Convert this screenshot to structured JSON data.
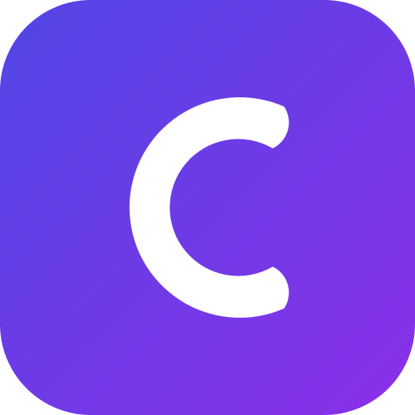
{
  "icon": {
    "name": "c-letter-app-icon",
    "glyph": "C",
    "colors": {
      "gradient_start": "#5146E5",
      "gradient_end": "#8B2FE8",
      "glyph": "#FFFFFF",
      "background": "#FFFFFF"
    }
  }
}
